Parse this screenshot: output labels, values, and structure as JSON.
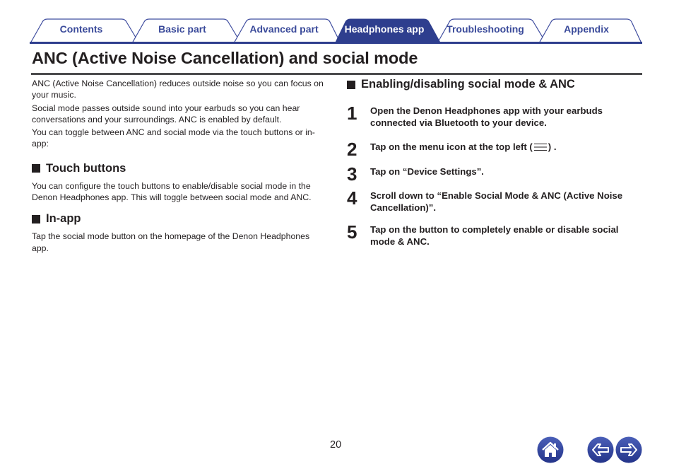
{
  "tabs": [
    {
      "label": "Contents",
      "active": false
    },
    {
      "label": "Basic part",
      "active": false
    },
    {
      "label": "Advanced part",
      "active": false
    },
    {
      "label": "Headphones app",
      "active": true
    },
    {
      "label": "Troubleshooting",
      "active": false
    },
    {
      "label": "Appendix",
      "active": false
    }
  ],
  "colors": {
    "accent": "#2e3e8e",
    "tab_text": "#3a4a9a",
    "title_rule": "#4b4b4d",
    "nav_button": "#2f3f93"
  },
  "page_title": "ANC (Active Noise Cancellation) and social mode",
  "intro": [
    "ANC (Active Noise Cancellation) reduces outside noise so you can focus on your music.",
    "Social mode passes outside sound into your earbuds so you can hear conversations and your surroundings. ANC is enabled by default.",
    "You can toggle between ANC and social mode via the touch buttons or in-app:"
  ],
  "sections": [
    {
      "heading": "Touch buttons",
      "body": "You can configure the touch buttons to enable/disable social mode in the Denon Headphones app. This will toggle between social mode and ANC."
    },
    {
      "heading": "In-app",
      "body": "Tap the social mode button on the homepage of the Denon Headphones app."
    }
  ],
  "procedure": {
    "heading": "Enabling/disabling social mode & ANC",
    "steps": [
      {
        "num": "1",
        "text": "Open the Denon Headphones app with your earbuds connected via Bluetooth to your device."
      },
      {
        "num": "2",
        "text_before": "Tap on the menu icon at the top left (",
        "icon": "menu-icon",
        "text_after": ") ."
      },
      {
        "num": "3",
        "text": "Tap on “Device Settings”."
      },
      {
        "num": "4",
        "text": "Scroll down to “Enable Social Mode & ANC (Active Noise Cancellation)”."
      },
      {
        "num": "5",
        "text": "Tap on the button to completely enable or disable social mode & ANC."
      }
    ]
  },
  "footer": {
    "page_number": "20",
    "buttons": [
      {
        "name": "home",
        "icon": "home-icon"
      },
      {
        "name": "back",
        "icon": "arrow-left-icon"
      },
      {
        "name": "forward",
        "icon": "arrow-right-icon"
      }
    ]
  }
}
